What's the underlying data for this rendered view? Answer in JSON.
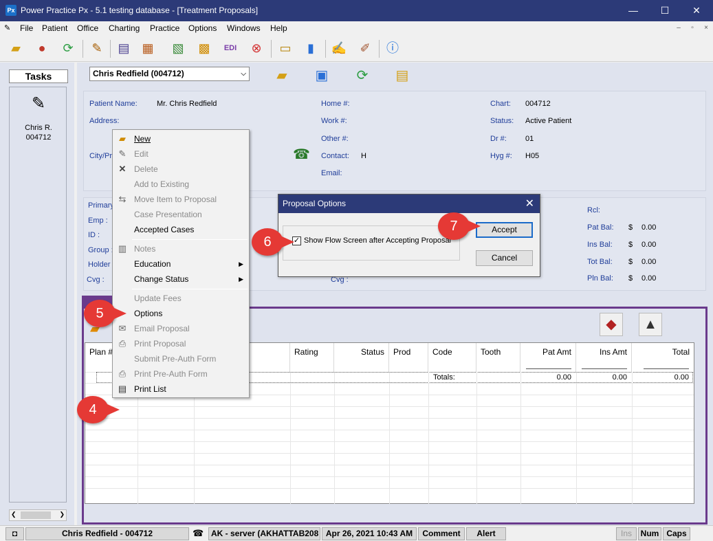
{
  "window": {
    "title": "Power Practice Px - 5.1 testing database - [Treatment Proposals]",
    "logo_text": "Px",
    "minimize": "—",
    "maximize": "☐",
    "close": "✕"
  },
  "menubar": [
    "File",
    "Patient",
    "Office",
    "Charting",
    "Practice",
    "Options",
    "Windows",
    "Help"
  ],
  "mdi_controls": [
    "–",
    "▫",
    "×"
  ],
  "tasks": {
    "title": "Tasks",
    "patient_name": "Chris R.",
    "patient_id": "004712"
  },
  "patient_selector": {
    "value": "Chris Redfield (004712)",
    "arrow": "⌵"
  },
  "patient_info": {
    "name_label": "Patient Name:",
    "name_value": "Mr. Chris Redfield",
    "address_label": "Address:",
    "city_label": "City/Pr",
    "home_label": "Home #:",
    "work_label": "Work #:",
    "other_label": "Other #:",
    "contact_label": "Contact:",
    "contact_value": "H",
    "email_label": "Email:",
    "chart_label": "Chart:",
    "chart_value": "004712",
    "status_label": "Status:",
    "status_value": "Active Patient",
    "dr_label": "Dr #:",
    "dr_value": "01",
    "hyg_label": "Hyg #:",
    "hyg_value": "H05"
  },
  "insurance": {
    "primary_label": "Primary",
    "emp_label": "Emp :",
    "id_label": "ID :",
    "group_label": "Group :",
    "holder_label": "Holder",
    "cvg_label": "Cvg :",
    "cvg2_label": "Cvg :",
    "rcl_label": "Rcl:",
    "pat_bal_label": "Pat Bal:",
    "ins_bal_label": "Ins Bal:",
    "tot_bal_label": "Tot Bal:",
    "pln_bal_label": "Pln Bal:",
    "currency": "$",
    "pat_bal": "0.00",
    "ins_bal": "0.00",
    "tot_bal": "0.00",
    "pln_bal": "0.00"
  },
  "grid": {
    "headers": [
      "Plan #",
      "Rating",
      "Status",
      "Prod",
      "Code",
      "Tooth",
      "Pat Amt",
      "Ins Amt",
      "Total"
    ],
    "totals_label": "Totals:",
    "pat_amt_total": "0.00",
    "ins_amt_total": "0.00",
    "total_total": "0.00"
  },
  "context_menu": {
    "new": "New",
    "edit": "Edit",
    "delete": "Delete",
    "add_to_existing": "Add to Existing",
    "move_item": "Move Item to Proposal",
    "case_presentation": "Case Presentation",
    "accepted_cases": "Accepted Cases",
    "notes": "Notes",
    "education": "Education",
    "change_status": "Change Status",
    "update_fees": "Update Fees",
    "options": "Options",
    "email_proposal": "Email Proposal",
    "print_proposal": "Print Proposal",
    "submit_preauth": "Submit Pre-Auth Form",
    "print_preauth": "Print Pre-Auth Form",
    "print_list": "Print List",
    "submenu_arrow": "▶"
  },
  "dialog": {
    "title": "Proposal Options",
    "close": "✕",
    "checkbox_label": "Show Flow Screen after Accepting Proposal",
    "checkbox_mark": "✓",
    "accept": "Accept",
    "cancel": "Cancel"
  },
  "callouts": [
    "4",
    "5",
    "6",
    "7"
  ],
  "statusbar": {
    "patient": "Chris Redfield - 004712",
    "server": "AK - server (AKHATTAB208",
    "datetime": "Apr 26, 2021 10:43 AM",
    "comment": "Comment",
    "alert": "Alert",
    "ins": "Ins",
    "num": "Num",
    "caps": "Caps"
  },
  "colors": {
    "titlebar": "#2c3a78",
    "proposal_frame": "#6a3a8c",
    "label_blue": "#1f3d99",
    "callout_red": "#e53935"
  }
}
